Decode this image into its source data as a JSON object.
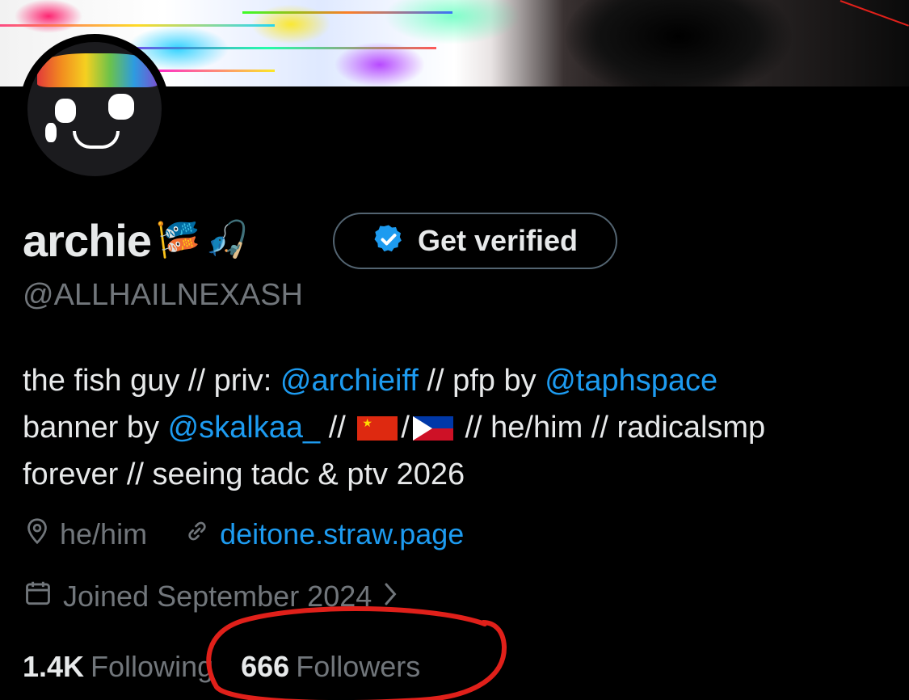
{
  "profile": {
    "display_name": "archie",
    "name_emojis": [
      "🎏",
      "🎣"
    ],
    "verify_button_label": "Get verified",
    "handle": "@ALLHAILNEXASH",
    "bio": {
      "line1_a": "the fish guy // priv: ",
      "mention1": "@archieiff",
      "line1_b": " // pfp by ",
      "mention2": "@taphspace",
      "line2_a": "banner by ",
      "mention3": "@skalkaa_",
      "line2_b": " // ",
      "flag_sep": "/",
      "line2_c": " // he/him // radicalsmp",
      "line3": "forever // seeing tadc & ptv 2026"
    },
    "location": "he/him",
    "website": "deitone.straw.page",
    "joined": "Joined September 2024",
    "following_count": "1.4K",
    "following_label": "Following",
    "followers_count": "666",
    "followers_label": "Followers"
  },
  "colors": {
    "accent": "#1d9bf0",
    "muted": "#71767b",
    "annotation": "#e0201a"
  },
  "icons": {
    "verified": "verified-badge-icon",
    "location": "location-pin-icon",
    "link": "link-icon",
    "calendar": "calendar-icon",
    "chevron": "chevron-right-icon"
  }
}
